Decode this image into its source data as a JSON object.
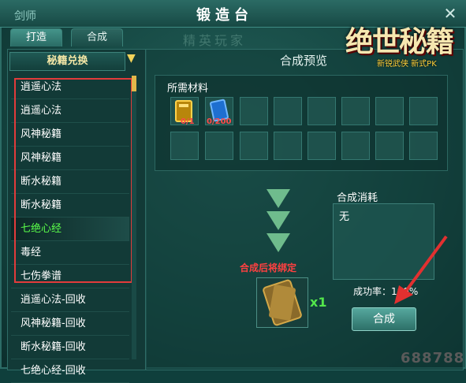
{
  "window": {
    "title": "锻造台",
    "corner_text": "剑师",
    "close_glyph": "✕"
  },
  "tabs": [
    {
      "label": "打造",
      "active": true
    },
    {
      "label": "合成",
      "active": false
    }
  ],
  "background_faint_text": "精英玩家",
  "sidebar": {
    "dropdown_label": "秘籍兑换",
    "items": [
      {
        "label": "逍遥心法",
        "selected": false
      },
      {
        "label": "逍遥心法",
        "selected": false
      },
      {
        "label": "风神秘籍",
        "selected": false
      },
      {
        "label": "风神秘籍",
        "selected": false
      },
      {
        "label": "断水秘籍",
        "selected": false
      },
      {
        "label": "断水秘籍",
        "selected": false
      },
      {
        "label": "七绝心经",
        "selected": true
      },
      {
        "label": "毒经",
        "selected": false
      },
      {
        "label": "七伤拳谱",
        "selected": false
      },
      {
        "label": "逍遥心法-回收",
        "selected": false
      },
      {
        "label": "风神秘籍-回收",
        "selected": false
      },
      {
        "label": "断水秘籍-回收",
        "selected": false
      },
      {
        "label": "七绝心经-回收",
        "selected": false
      }
    ]
  },
  "preview": {
    "title": "合成预览",
    "materials_label": "所需材料",
    "materials": [
      {
        "icon": "gold-book-icon",
        "count": "0/1"
      },
      {
        "icon": "blue-book-icon",
        "count": "0/200"
      }
    ],
    "bind_notice": "合成后将绑定",
    "result_quantity": "x1"
  },
  "cost": {
    "title": "合成消耗",
    "value": "无",
    "success_rate": "成功率：100%",
    "compose_button": "合成"
  },
  "logo": {
    "title": "绝世秘籍",
    "subtitle": "新锐武侠 新式PK"
  },
  "watermark": "688788",
  "colors": {
    "selected_item": "#5bff4a",
    "highlight_box": "#e23b3b",
    "bind_notice": "#ff4040"
  }
}
